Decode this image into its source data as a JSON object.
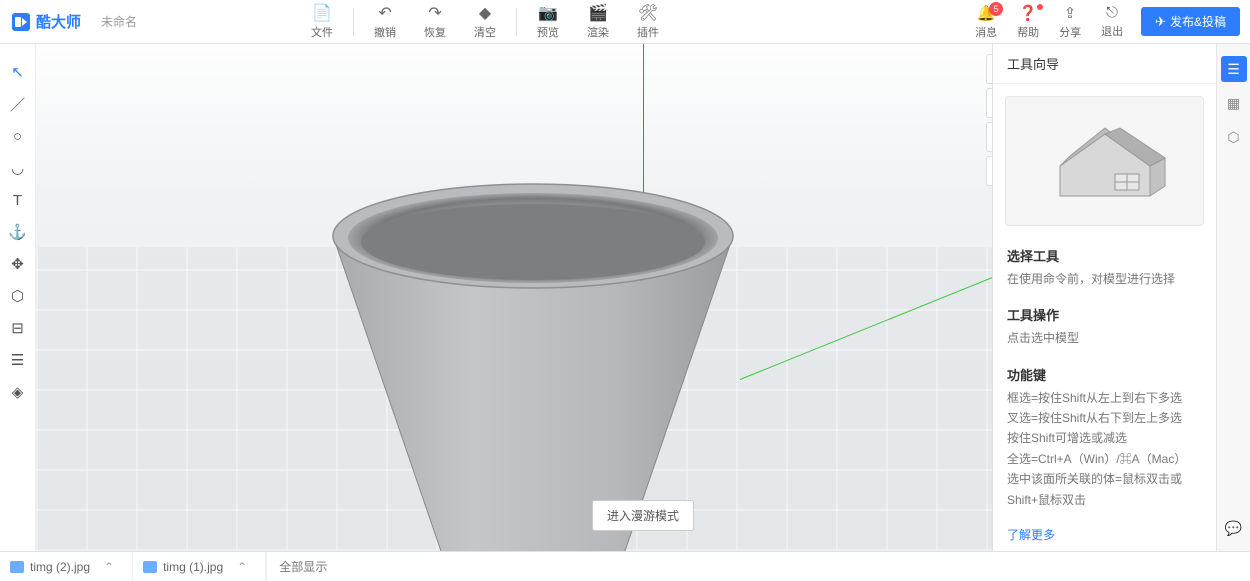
{
  "app": {
    "name": "酷大师",
    "doc": "未命名"
  },
  "toolbar": {
    "file": "文件",
    "undo": "撤销",
    "redo": "恢复",
    "clear": "清空",
    "preview": "预览",
    "render": "渲染",
    "plugin": "插件"
  },
  "actions": {
    "message": "消息",
    "help": "帮助",
    "share": "分享",
    "exit": "退出",
    "publish": "发布&投稿",
    "msg_count": "5"
  },
  "roam": "进入漫游模式",
  "guide": {
    "header": "工具向导",
    "select_title": "选择工具",
    "select_desc": "在使用命令前，对模型进行选择",
    "op_title": "工具操作",
    "op_desc": "点击选中模型",
    "fn_title": "功能键",
    "fn_l1": "框选=按住Shift从左上到右下多选",
    "fn_l2": "叉选=按住Shift从右下到左上多选",
    "fn_l3": "按住Shift可增选或减选",
    "fn_l4": "全选=Ctrl+A（Win）/⌘A（Mac）",
    "fn_l5": "选中该面所关联的体=鼠标双击或Shift+鼠标双击",
    "more": "了解更多"
  },
  "tabs": {
    "t1": "timg (2).jpg",
    "t2": "timg (1).jpg",
    "showall": "全部显示"
  }
}
